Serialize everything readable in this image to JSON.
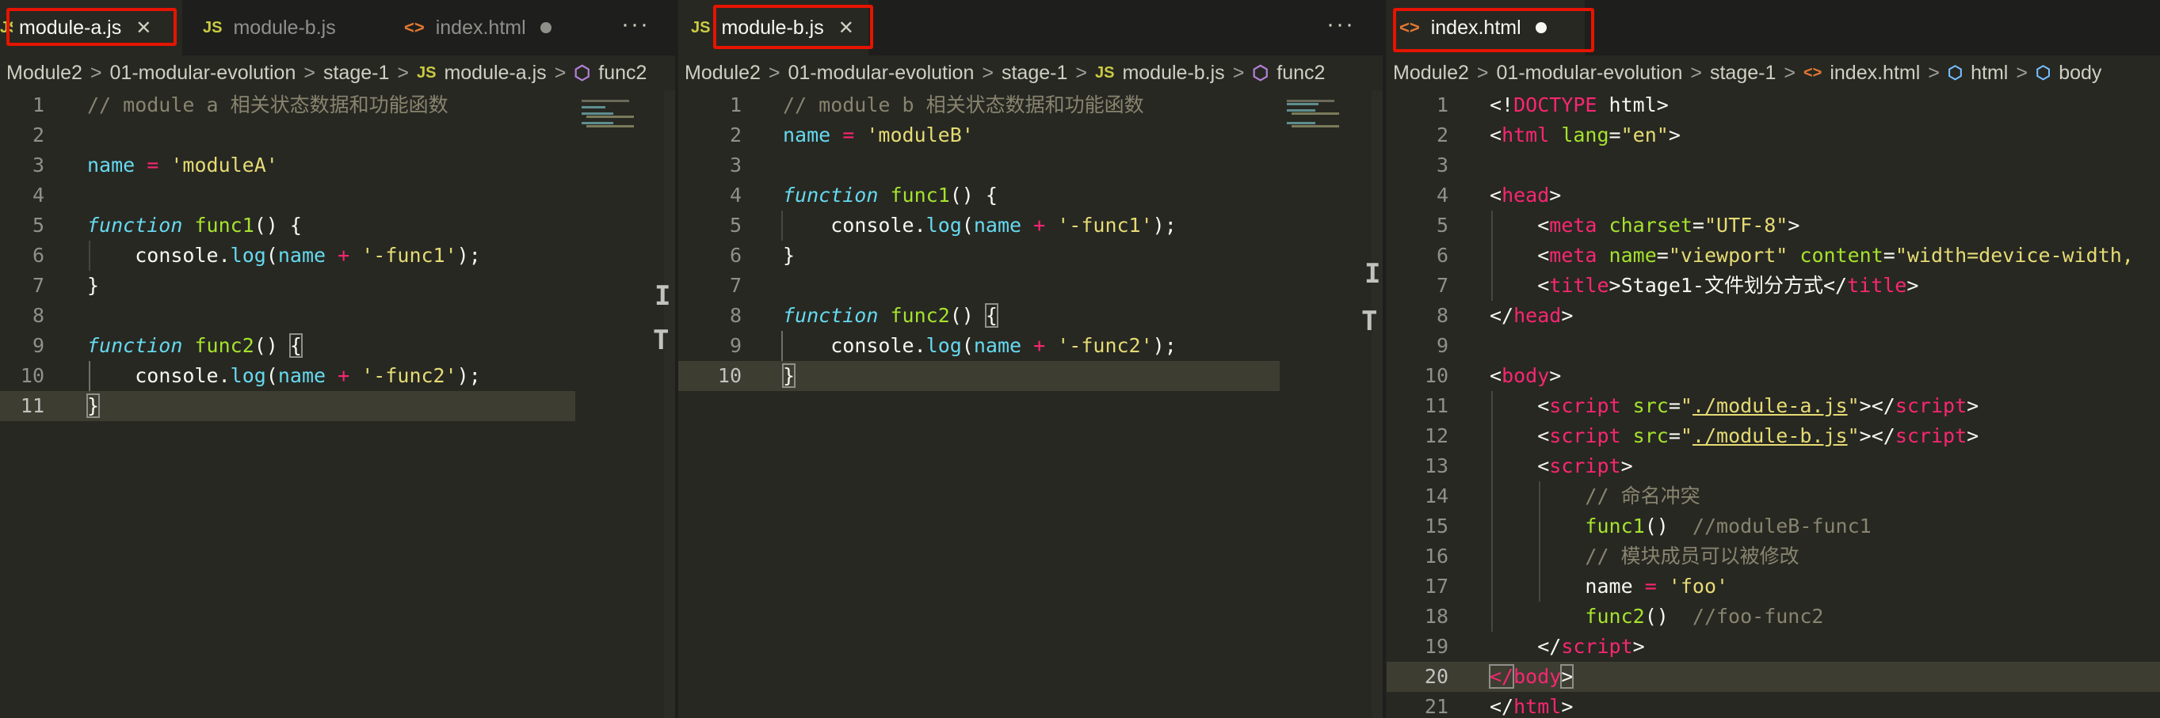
{
  "colors": {
    "editor_bg": "#272822",
    "tabbar_bg": "#1e1f1c",
    "highlight_box": "#e51400",
    "keyword": "#66d9ef",
    "function": "#a6e22e",
    "operator": "#f92672",
    "string": "#e6db74",
    "comment": "#88846f"
  },
  "panes": [
    {
      "tabs": [
        {
          "icon": "JS",
          "label": "module-a.js",
          "state": "active-close"
        },
        {
          "icon": "JS",
          "label": "module-b.js",
          "state": "normal"
        },
        {
          "icon": "<>",
          "label": "index.html",
          "state": "modified"
        }
      ],
      "more": "···",
      "breadcrumb": [
        "Module2",
        "01-modular-evolution",
        "stage-1",
        "module-a.js",
        "func2"
      ],
      "lines": [
        "1",
        "2",
        "3",
        "4",
        "5",
        "6",
        "7",
        "8",
        "9",
        "10",
        "11"
      ]
    },
    {
      "tabs": [
        {
          "icon": "JS",
          "label": "module-b.js",
          "state": "active-close"
        }
      ],
      "more": "···",
      "breadcrumb": [
        "Module2",
        "01-modular-evolution",
        "stage-1",
        "module-b.js",
        "func2"
      ],
      "lines": [
        "1",
        "2",
        "3",
        "4",
        "5",
        "6",
        "7",
        "8",
        "9",
        "10"
      ]
    },
    {
      "tabs": [
        {
          "icon": "<>",
          "label": "index.html",
          "state": "active-modified"
        }
      ],
      "breadcrumb": [
        "Module2",
        "01-modular-evolution",
        "stage-1",
        "index.html",
        "html",
        "body"
      ],
      "lines": [
        "1",
        "2",
        "3",
        "4",
        "5",
        "6",
        "7",
        "8",
        "9",
        "10",
        "11",
        "12",
        "13",
        "14",
        "15",
        "16",
        "17",
        "18",
        "19",
        "20",
        "21"
      ]
    }
  ],
  "code": {
    "a": {
      "l1": "// module a 相关状态数据和功能函数",
      "l3_name": "name",
      "l3_eq": " = ",
      "l3_val": "'moduleA'",
      "l5_kw": "function",
      "l5_fn": "func1",
      "l5_rest": "() {",
      "l6_obj": "console",
      "l6_dot": ".",
      "l6_fn": "log",
      "l6_p1": "(",
      "l6_name": "name",
      "l6_plus": " + ",
      "l6_str": "'-func1'",
      "l6_end": ");",
      "l7": "}",
      "l9_kw": "function",
      "l9_fn": "func2",
      "l9_rest": "() ",
      "l9_br": "{",
      "l10_obj": "console",
      "l10_dot": ".",
      "l10_fn": "log",
      "l10_p1": "(",
      "l10_name": "name",
      "l10_plus": " + ",
      "l10_str": "'-func2'",
      "l10_end": ");",
      "l11_br": "}"
    },
    "b": {
      "l1": "// module b 相关状态数据和功能函数",
      "l2_name": "name",
      "l2_eq": " = ",
      "l2_val": "'moduleB'",
      "l4_kw": "function",
      "l4_fn": "func1",
      "l4_rest": "() {",
      "l5_obj": "console",
      "l5_dot": ".",
      "l5_fn": "log",
      "l5_p1": "(",
      "l5_name": "name",
      "l5_plus": " + ",
      "l5_str": "'-func1'",
      "l5_end": ");",
      "l6": "}",
      "l8_kw": "function",
      "l8_fn": "func2",
      "l8_rest": "() ",
      "l8_br": "{",
      "l9_obj": "console",
      "l9_dot": ".",
      "l9_fn": "log",
      "l9_p1": "(",
      "l9_name": "name",
      "l9_plus": " + ",
      "l9_str": "'-func2'",
      "l9_end": ");",
      "l10_br": "}"
    },
    "h": {
      "l1_a": "<!",
      "l1_b": "DOCTYPE",
      "l1_c": " html",
      "l1_d": ">",
      "l2_a": "<",
      "l2_tag": "html",
      "l2_attr": " lang",
      "l2_eq": "=",
      "l2_val": "\"en\"",
      "l2_close": ">",
      "l4_a": "<",
      "l4_tag": "head",
      "l4_close": ">",
      "l5_a": "<",
      "l5_tag": "meta",
      "l5_attr": " charset",
      "l5_eq": "=",
      "l5_val": "\"UTF-8\"",
      "l5_close": ">",
      "l6_a": "<",
      "l6_tag": "meta",
      "l6_attr1": " name",
      "l6_eq1": "=",
      "l6_val1": "\"viewport\"",
      "l6_attr2": " content",
      "l6_eq2": "=",
      "l6_val2": "\"width=device-width,",
      "l7_a": "<",
      "l7_tag": "title",
      "l7_close": ">",
      "l7_text": "Stage1-文件划分方式",
      "l7_b": "</",
      "l7_tag2": "title",
      "l7_close2": ">",
      "l8_a": "</",
      "l8_tag": "head",
      "l8_close": ">",
      "l10_a": "<",
      "l10_tag": "body",
      "l10_close": ">",
      "l11_a": "<",
      "l11_tag": "script",
      "l11_attr": " src",
      "l11_eq": "=",
      "l11_q1": "\"",
      "l11_link": "./module-a.js",
      "l11_q2": "\"",
      "l11_mid": "></",
      "l11_tag2": "script",
      "l11_close": ">",
      "l12_a": "<",
      "l12_tag": "script",
      "l12_attr": " src",
      "l12_eq": "=",
      "l12_q1": "\"",
      "l12_link": "./module-b.js",
      "l12_q2": "\"",
      "l12_mid": "></",
      "l12_tag2": "script",
      "l12_close": ">",
      "l13_a": "<",
      "l13_tag": "script",
      "l13_close": ">",
      "l14": "// 命名冲突",
      "l15_fn": "func1",
      "l15_p": "()",
      "l15_cm": "  //moduleB-func1",
      "l16": "// 模块成员可以被修改",
      "l17_name": "name",
      "l17_eq": " = ",
      "l17_val": "'foo'",
      "l18_fn": "func2",
      "l18_p": "()",
      "l18_cm": "  //foo-func2",
      "l19_a": "</",
      "l19_tag": "script",
      "l19_close": ">",
      "l20_a": "</",
      "l20_tag": "body",
      "l20_close": ">",
      "l21_a": "</",
      "l21_tag": "html",
      "l21_close": ">"
    }
  }
}
